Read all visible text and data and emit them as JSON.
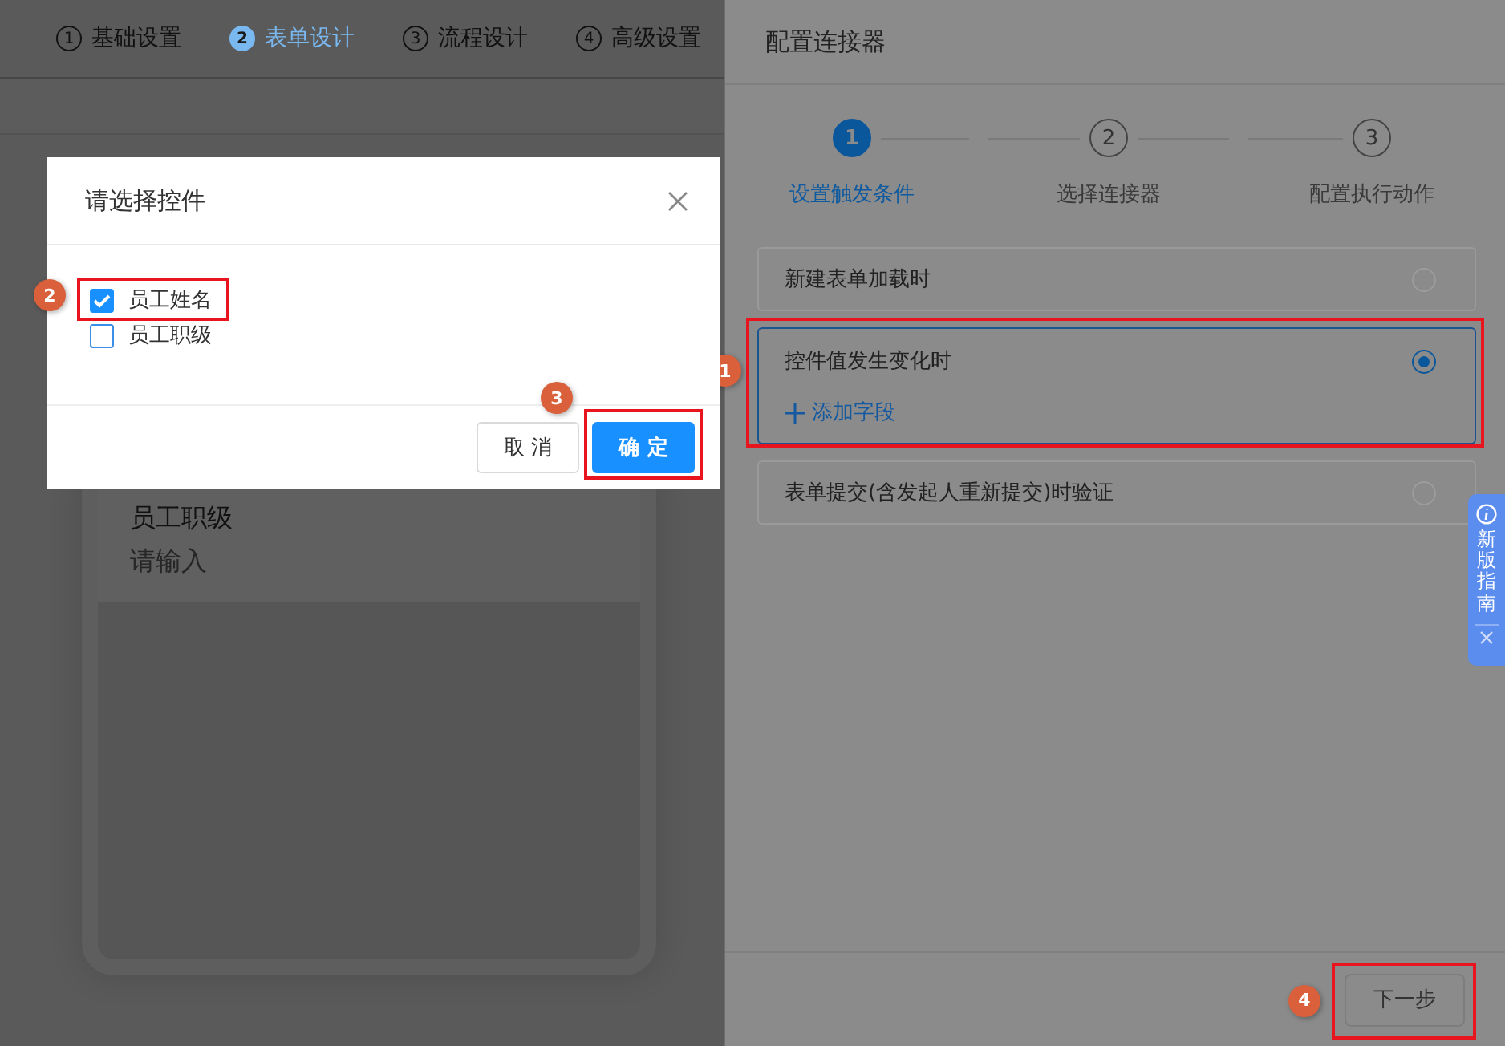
{
  "top_steps": [
    {
      "number": "1",
      "label": "基础设置",
      "selected": false
    },
    {
      "number": "2",
      "label": "表单设计",
      "selected": true
    },
    {
      "number": "3",
      "label": "流程设计",
      "selected": false
    },
    {
      "number": "4",
      "label": "高级设置",
      "selected": false
    }
  ],
  "form_preview": {
    "field_label": "员工职级",
    "placeholder": "请输入"
  },
  "dialog": {
    "title": "请选择控件",
    "options": [
      {
        "label": "员工姓名",
        "checked": true,
        "annotation": "2"
      },
      {
        "label": "员工职级",
        "checked": false
      }
    ],
    "buttons": [
      {
        "label": "取 消",
        "kind": "default"
      },
      {
        "label": "确 定",
        "kind": "primary",
        "annotation": "3"
      }
    ]
  },
  "panel": {
    "title": "配置连接器",
    "steps": [
      {
        "number": "1",
        "label": "设置触发条件",
        "selected": true
      },
      {
        "number": "2",
        "label": "选择连接器",
        "selected": false
      },
      {
        "number": "3",
        "label": "配置执行动作",
        "selected": false
      }
    ],
    "triggers": [
      {
        "label": "新建表单加载时",
        "selected": false
      },
      {
        "label": "控件值发生变化时",
        "selected": true,
        "action": "添加字段",
        "annotation": "1"
      },
      {
        "label": "表单提交(含发起人重新提交)时验证",
        "selected": false
      }
    ],
    "next_button": {
      "label": "下一步",
      "disabled": true,
      "annotation": "4"
    }
  },
  "guide_tab": {
    "label": "新版指南"
  }
}
